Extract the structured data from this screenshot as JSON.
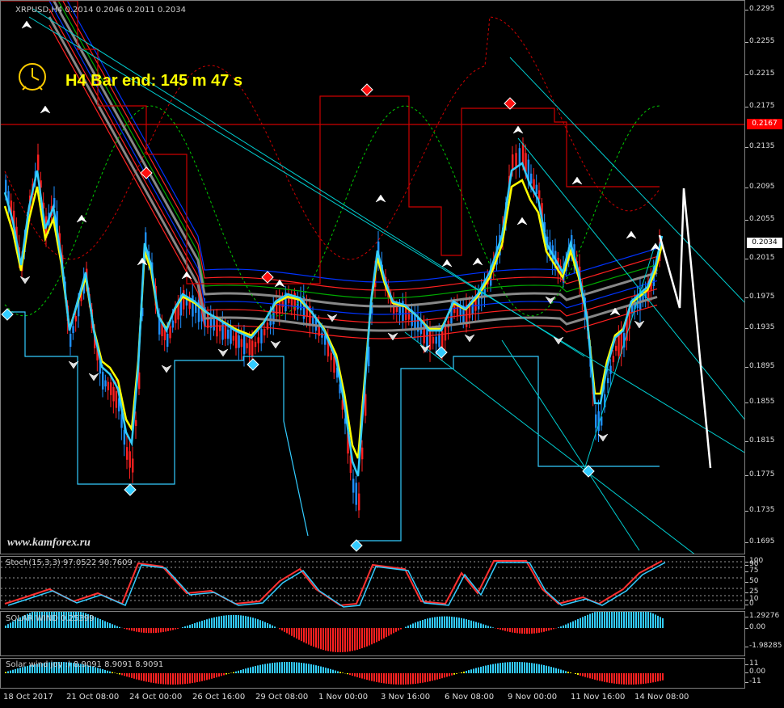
{
  "chart": {
    "symbol_header": "XRPUSD,H4  0.2014 0.2046 0.2011 0.2034",
    "bar_end_text": "H4 Bar end: 145 m 47 s",
    "watermark": "www.kamforex.ru",
    "current_price": "0.2034",
    "hline_price": "0.2167",
    "price_scale": [
      "0.2295",
      "0.2255",
      "0.2215",
      "0.2175",
      "0.2135",
      "0.2095",
      "0.2055",
      "0.2015",
      "0.1975",
      "0.1935",
      "0.1895",
      "0.1855",
      "0.1815",
      "0.1775",
      "0.1735",
      "0.1695"
    ]
  },
  "stoch": {
    "title": "Stoch(15,3,3) 97.0522 90.7609",
    "scale": [
      "100",
      "90",
      "75",
      "50",
      "25",
      "10",
      "0"
    ]
  },
  "solar_wind": {
    "title": "SOLAR WIND 0.25399",
    "scale": [
      "1.29276",
      "0.00",
      "-1.98285"
    ]
  },
  "solar_joy": {
    "title": "Solar wind joy :) 8.9091 8.9091 8.9091",
    "scale": [
      "11",
      "0.00",
      "-11"
    ]
  },
  "time_axis": [
    "18 Oct 2017",
    "21 Oct 08:00",
    "24 Oct 00:00",
    "26 Oct 16:00",
    "29 Oct 08:00",
    "1 Nov 00:00",
    "3 Nov 16:00",
    "6 Nov 08:00",
    "9 Nov 00:00",
    "11 Nov 16:00",
    "14 Nov 08:00"
  ],
  "colors": {
    "background": "#000000",
    "bull_candle": "#1e90ff",
    "bear_candle": "#ff2020",
    "yellow_ma": "#ffff00",
    "skyblue_ma": "#33ccff",
    "trend_lines": "#00ced1",
    "resistance": "#ff0000",
    "text_yellow": "#ffff00"
  }
}
